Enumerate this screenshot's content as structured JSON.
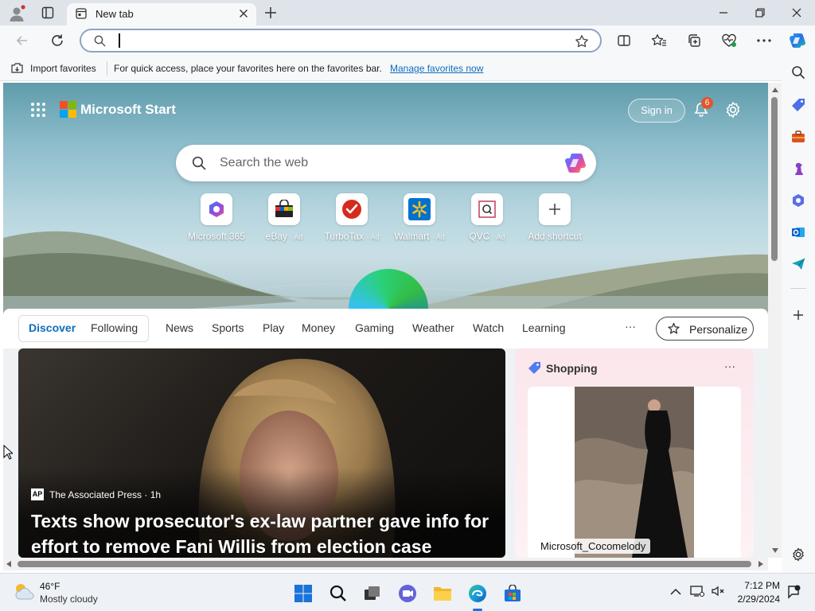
{
  "browser": {
    "tab_title": "New tab",
    "address_value": "",
    "favorites_bar": {
      "import_label": "Import favorites",
      "hint_text": "For quick access, place your favorites here on the favorites bar.",
      "manage_link": "Manage favorites now"
    }
  },
  "page": {
    "brand": "Microsoft Start",
    "sign_in_label": "Sign in",
    "notification_count": "6",
    "search_placeholder": "Search the web",
    "quick_links": [
      {
        "label": "Microsoft 365",
        "ad": ""
      },
      {
        "label": "eBay",
        "ad": "· Ad"
      },
      {
        "label": "TurboTax",
        "ad": "· Ad"
      },
      {
        "label": "Walmart",
        "ad": "· Ad"
      },
      {
        "label": "QVC",
        "ad": "· Ad"
      },
      {
        "label": "Add shortcut",
        "ad": ""
      }
    ],
    "feed_tabs": [
      "Discover",
      "Following",
      "News",
      "Sports",
      "Play",
      "Money",
      "Gaming",
      "Weather",
      "Watch",
      "Learning"
    ],
    "more_label": "···",
    "personalize_label": "Personalize",
    "main_article": {
      "source_logo": "AP",
      "source": "The Associated Press · 1h",
      "headline_line1": "Texts show prosecutor's ex-law partner gave info for",
      "headline_line2": "effort to remove Fani Willis from election case"
    },
    "shopping": {
      "title": "Shopping",
      "more_label": "···",
      "product_caption": "Microsoft_Cocomelody"
    }
  },
  "taskbar": {
    "weather_temp": "46°F",
    "weather_desc": "Mostly cloudy",
    "time": "7:12 PM",
    "date": "2/29/2024"
  },
  "colors": {
    "accent": "#0f6cbd",
    "link": "#0f6cbd",
    "notification_badge": "#e0562c"
  }
}
